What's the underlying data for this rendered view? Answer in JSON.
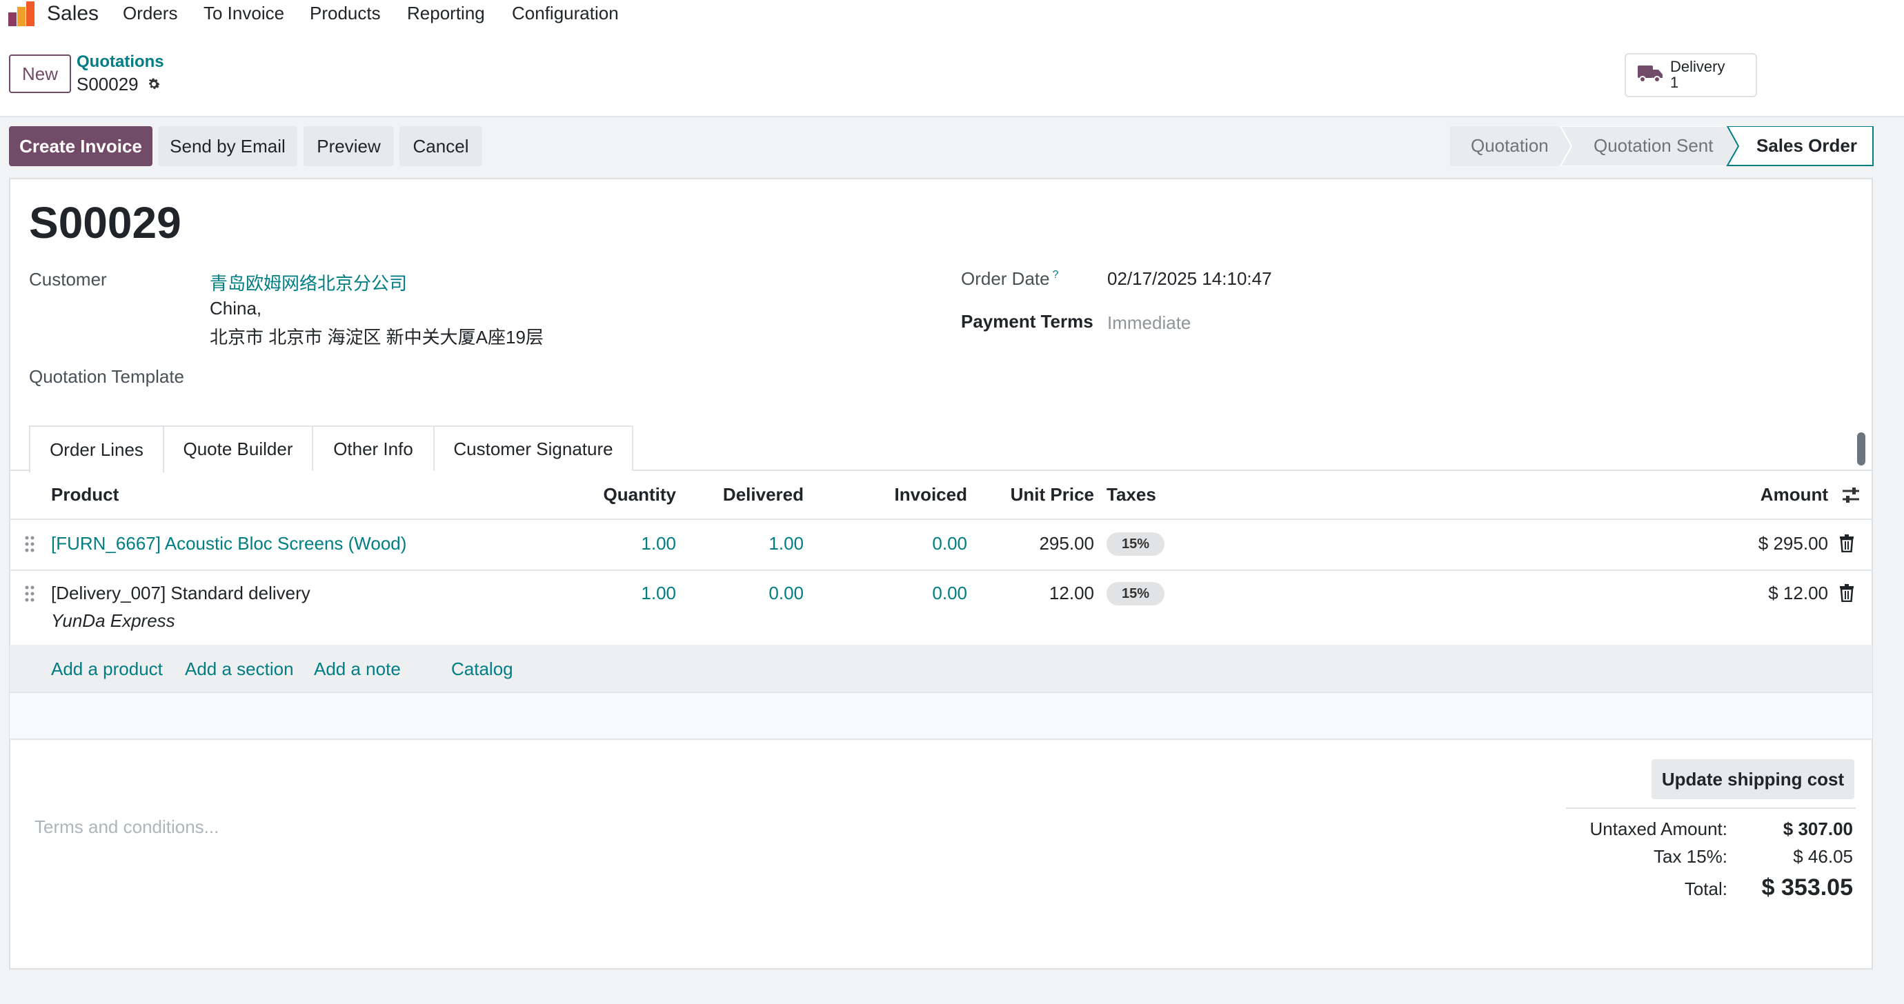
{
  "nav": {
    "app_name": "Sales",
    "items": [
      "Orders",
      "To Invoice",
      "Products",
      "Reporting",
      "Configuration"
    ]
  },
  "control_panel": {
    "new_label": "New",
    "breadcrumb_parent": "Quotations",
    "breadcrumb_current": "S00029",
    "delivery_label": "Delivery",
    "delivery_count": "1"
  },
  "actions": {
    "create_invoice": "Create Invoice",
    "send_email": "Send by Email",
    "preview": "Preview",
    "cancel": "Cancel"
  },
  "statusbar": {
    "stages": [
      "Quotation",
      "Quotation Sent",
      "Sales Order"
    ],
    "active": "Sales Order"
  },
  "form": {
    "title": "S00029",
    "customer_label": "Customer",
    "customer_name": "青岛欧姆网络北京分公司",
    "customer_address_line1": "China,",
    "customer_address_line2": "北京市 北京市 海淀区 新中关大厦A座19层",
    "quotation_template_label": "Quotation Template",
    "order_date_label": "Order Date",
    "order_date_help": "?",
    "order_date": "02/17/2025 14:10:47",
    "payment_terms_label": "Payment Terms",
    "payment_terms": "Immediate"
  },
  "tabs": [
    "Order Lines",
    "Quote Builder",
    "Other Info",
    "Customer Signature"
  ],
  "table": {
    "headers": {
      "product": "Product",
      "quantity": "Quantity",
      "delivered": "Delivered",
      "invoiced": "Invoiced",
      "unit_price": "Unit Price",
      "taxes": "Taxes",
      "amount": "Amount"
    },
    "rows": [
      {
        "product": "[FURN_6667] Acoustic Bloc Screens (Wood)",
        "description": "",
        "quantity": "1.00",
        "delivered": "1.00",
        "invoiced": "0.00",
        "unit_price": "295.00",
        "tax": "15%",
        "amount": "$ 295.00"
      },
      {
        "product": "[Delivery_007] Standard delivery",
        "description": "YunDa Express",
        "quantity": "1.00",
        "delivered": "0.00",
        "invoiced": "0.00",
        "unit_price": "12.00",
        "tax": "15%",
        "amount": "$ 12.00"
      }
    ],
    "add_links": {
      "add_product": "Add a product",
      "add_section": "Add a section",
      "add_note": "Add a note",
      "catalog": "Catalog"
    }
  },
  "footer": {
    "update_shipping": "Update shipping cost",
    "terms_placeholder": "Terms and conditions...",
    "untaxed_label": "Untaxed Amount:",
    "untaxed_value": "$ 307.00",
    "tax_label": "Tax 15%:",
    "tax_value": "$ 46.05",
    "total_label": "Total:",
    "total_value": "$ 353.05"
  },
  "colors": {
    "primary": "#714b67",
    "link": "#017e84",
    "secondary_button": "#e7e9ed"
  }
}
